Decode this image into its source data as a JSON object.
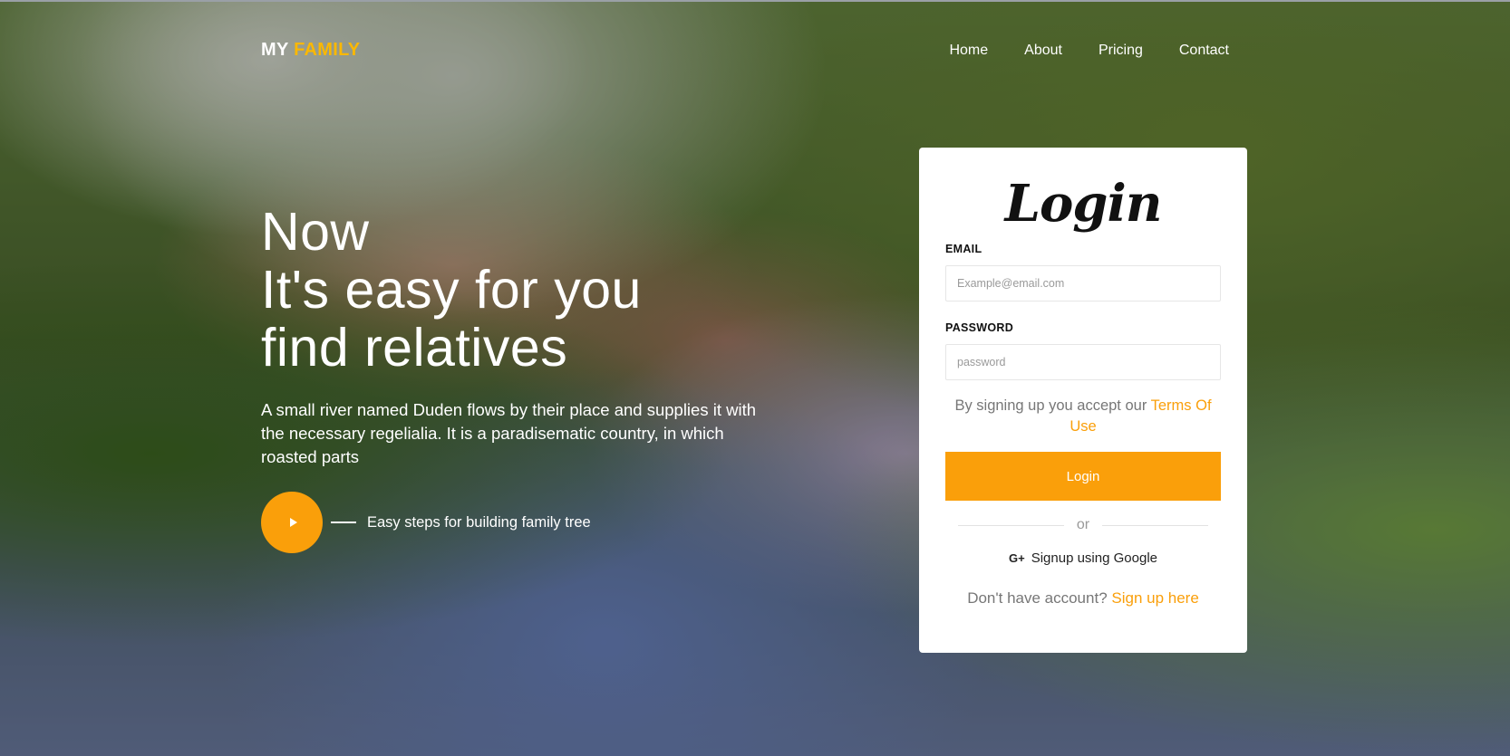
{
  "brand": {
    "part1": "MY",
    "part2": "FAMILY"
  },
  "nav": {
    "items": [
      "Home",
      "About",
      "Pricing",
      "Contact"
    ]
  },
  "hero": {
    "headline": [
      "Now",
      "It's easy for you",
      "find relatives"
    ],
    "description": "A small river named Duden flows by their place and supplies it with the necessary regelialia. It is a paradisematic country, in which roasted parts",
    "cta_text": "Easy steps for building family tree",
    "play_icon": "play-icon"
  },
  "login": {
    "title": "Login",
    "email_label": "EMAIL",
    "email_placeholder": "Example@email.com",
    "password_label": "PASSWORD",
    "password_placeholder": "password",
    "terms_prefix": "By signing up you accept our",
    "terms_link": "Terms Of Use",
    "button_label": "Login",
    "or_text": "or",
    "google_icon": "G+",
    "google_text": "Signup using Google",
    "signup_prefix": "Don't have account?",
    "signup_link": "Sign up here"
  },
  "colors": {
    "accent": "#fa9f0a",
    "brand_yellow": "#fbb800",
    "white": "#ffffff"
  }
}
